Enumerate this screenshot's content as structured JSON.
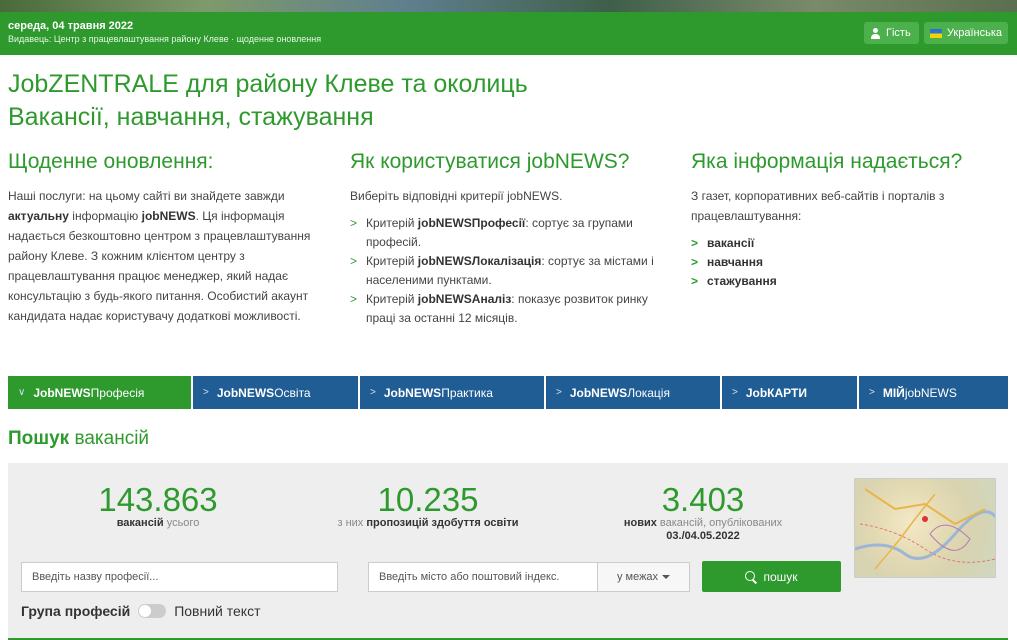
{
  "topbar": {
    "date": "середа, 04 травня 2022",
    "publisher": "Видавець: Центр з працевлаштування району Клеве · щоденне оновлення",
    "guest_label": "Гість",
    "language_label": "Українська"
  },
  "headline": {
    "line1": "JobZENTRALE для району Клеве та околиць",
    "line2": "Вакансії, навчання, стажування"
  },
  "col1": {
    "title": "Щоденне оновлення:",
    "t1": "Наші послуги: на цьому сайті ви знайдете завжди ",
    "b1": "актуальну",
    "t2": " інформацію ",
    "b2": "jobNEWS",
    "t3": ". Ця інформація надається безкоштовно центром з працевлаштування району Клеве. З кожним клієнтом центру з працевлаштування працює менеджер, який надає консультацію з будь-якого питання. Особистий акаунт кандидата надає користувачу додаткові можливості."
  },
  "col2": {
    "title": "Як користуватися jobNEWS?",
    "intro": "Виберіть відповідні критерії jobNEWS.",
    "items": [
      {
        "pre": "Критерій ",
        "bold": "jobNEWSПрофесії",
        "post": ": сортує за групами професій."
      },
      {
        "pre": "Критерій ",
        "bold": "jobNEWSЛокалізація",
        "post": ": сортує за містами і населеними пунктами."
      },
      {
        "pre": "Критерій ",
        "bold": "jobNEWSАналіз",
        "post": ": показує розвиток ринку праці за останні 12 місяців."
      }
    ]
  },
  "col3": {
    "title": "Яка інформація надається?",
    "intro": "З газет, корпоративних веб-сайтів і порталів з працевлаштування:",
    "items": [
      "вакансії",
      "навчання",
      "стажування"
    ]
  },
  "tabs": [
    {
      "bold": "JobNEWS",
      "rest": "Професія"
    },
    {
      "bold": "JobNEWS",
      "rest": "Освіта"
    },
    {
      "bold": "JobNEWS",
      "rest": "Практика"
    },
    {
      "bold": "JobNEWS",
      "rest": "Локація"
    },
    {
      "bold": "JobКАРТИ",
      "rest": ""
    },
    {
      "bold": "МІЙ",
      "rest": "jobNEWS"
    }
  ],
  "search": {
    "title_bold": "Пошук",
    "title_rest": " вакансій",
    "profession_placeholder": "Введіть назву професії...",
    "city_placeholder": "Введіть місто або поштовий індекс.",
    "within_label": "у межах",
    "search_button": "пошук",
    "toggle_left": "Група професій",
    "toggle_right": "Повний текст"
  },
  "stats": [
    {
      "num": "143.863",
      "cap_pre": "",
      "cap_bold": "вакансій",
      "cap_post": " усього",
      "cap_line2": ""
    },
    {
      "num": "10.235",
      "cap_pre": "з них ",
      "cap_bold": "пропозицій здобуття освіти",
      "cap_post": "",
      "cap_line2": ""
    },
    {
      "num": "3.403",
      "cap_pre": "",
      "cap_bold": "нових",
      "cap_post": " вакансій, опублікованих",
      "cap_line2": "03./04.05.2022"
    }
  ]
}
